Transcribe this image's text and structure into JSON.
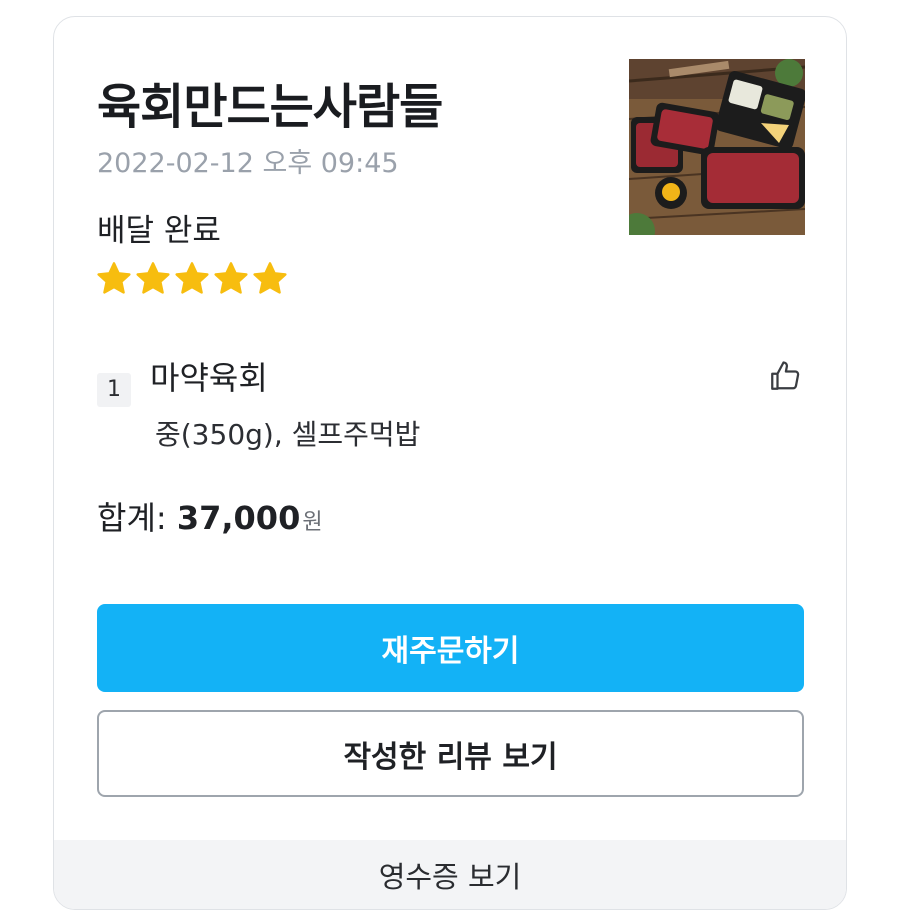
{
  "order": {
    "store_name": "육회만드는사람들",
    "datetime": "2022-02-12 오후 09:45",
    "status": "배달 완료",
    "rating": 5,
    "thumbnail_icon": "yukhoe-food-photo"
  },
  "items": [
    {
      "quantity": "1",
      "name": "마약육회",
      "options": "중(350g), 셀프주먹밥"
    }
  ],
  "total": {
    "label": "합계: ",
    "value": "37,000",
    "unit": "원"
  },
  "actions": {
    "reorder_label": "재주문하기",
    "view_review_label": "작성한 리뷰 보기",
    "view_receipt_label": "영수증 보기"
  },
  "colors": {
    "primary": "#13b2f6",
    "star": "#f7bd0f",
    "muted_text": "#9aa1ab"
  }
}
